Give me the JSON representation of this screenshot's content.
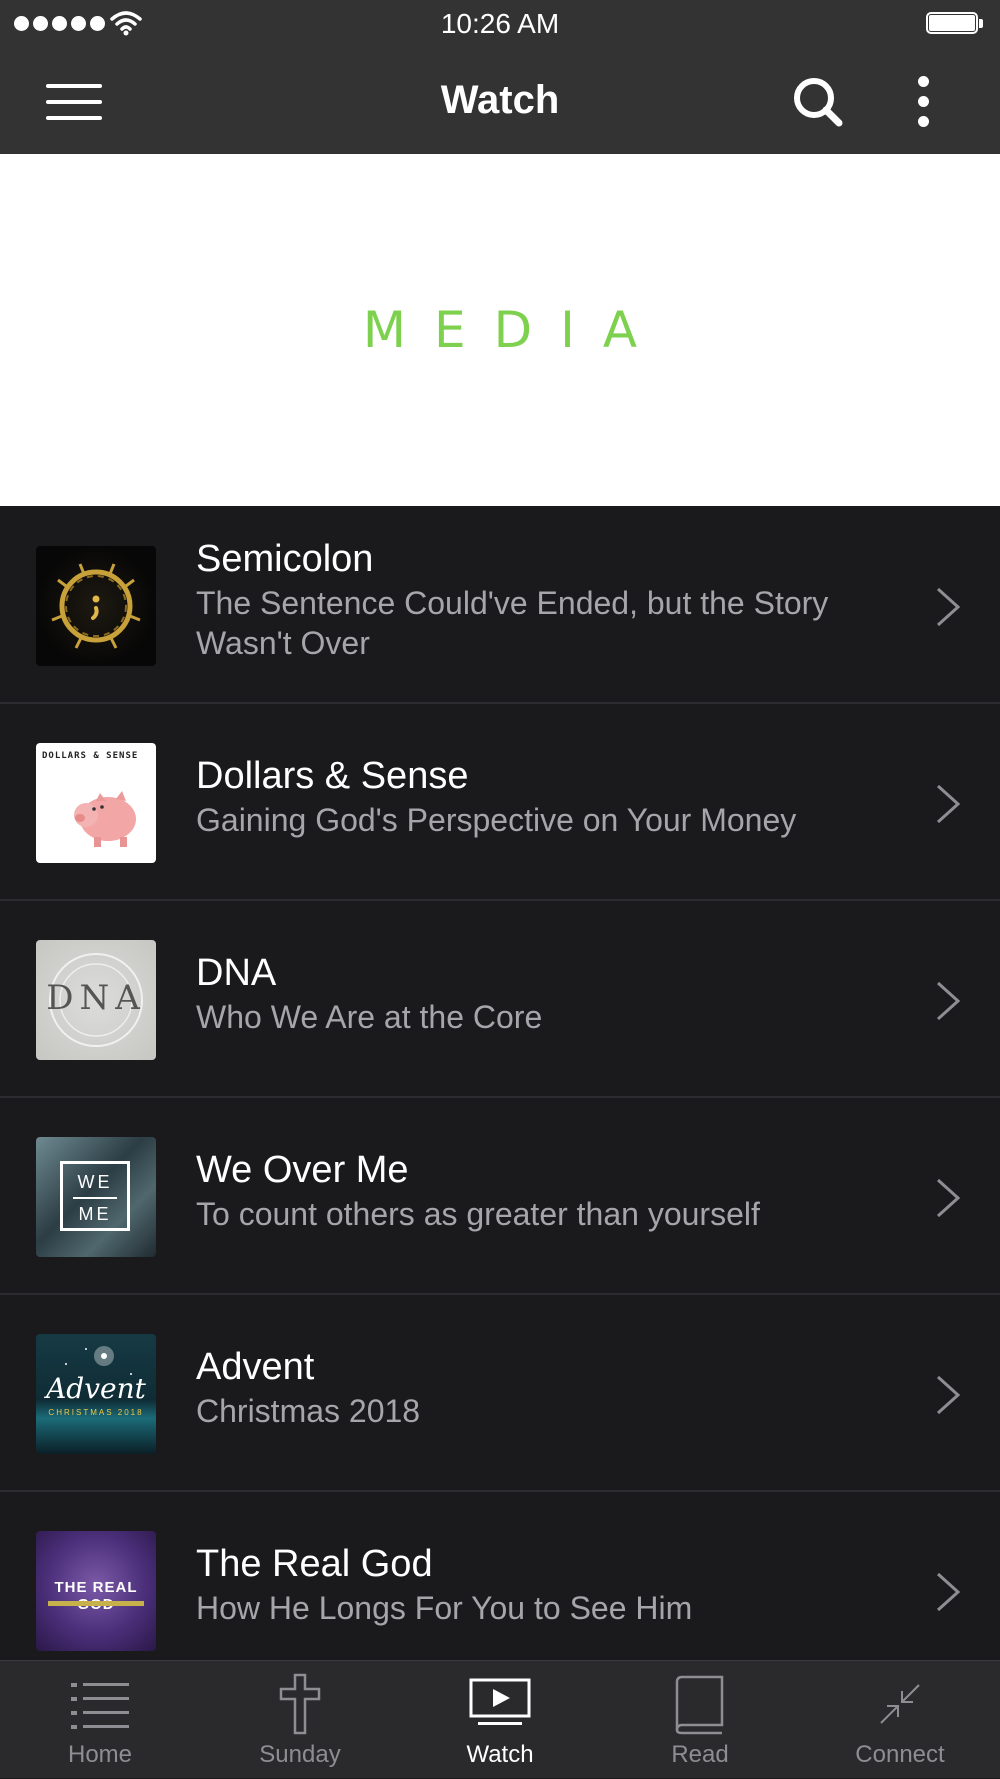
{
  "status_bar": {
    "time": "10:26 AM"
  },
  "nav": {
    "title": "Watch"
  },
  "banner": {
    "text": "MEDIA",
    "color": "#7ed14f"
  },
  "series": [
    {
      "title": "Semicolon",
      "subtitle": "The Sentence Could've Ended, but the Story Wasn't Over",
      "thumb_icon": "crown-of-thorns-semicolon"
    },
    {
      "title": "Dollars & Sense",
      "subtitle": "Gaining God's Perspective on Your Money",
      "thumb_icon": "piggy-bank",
      "thumb_text": "DOLLARS & SENSE"
    },
    {
      "title": "DNA",
      "subtitle": "Who We Are at the Core",
      "thumb_icon": "dna-art",
      "thumb_text": "DNA"
    },
    {
      "title": "We Over Me",
      "subtitle": "To count others as greater than yourself",
      "thumb_icon": "we-over-me-art",
      "thumb_text_top": "WE",
      "thumb_text_bottom": "ME"
    },
    {
      "title": "Advent",
      "subtitle": "Christmas 2018",
      "thumb_icon": "advent-art",
      "thumb_text": "Advent",
      "thumb_text_small": "CHRISTMAS 2018"
    },
    {
      "title": "The Real God",
      "subtitle": "How He Longs For You to See Him",
      "thumb_icon": "the-real-god-art",
      "thumb_text": "THE REAL GOD"
    }
  ],
  "tabs": [
    {
      "label": "Home",
      "icon": "list-icon",
      "active": false
    },
    {
      "label": "Sunday",
      "icon": "cross-icon",
      "active": false
    },
    {
      "label": "Watch",
      "icon": "tv-play-icon",
      "active": true
    },
    {
      "label": "Read",
      "icon": "book-icon",
      "active": false
    },
    {
      "label": "Connect",
      "icon": "connect-arrows-icon",
      "active": false
    }
  ]
}
